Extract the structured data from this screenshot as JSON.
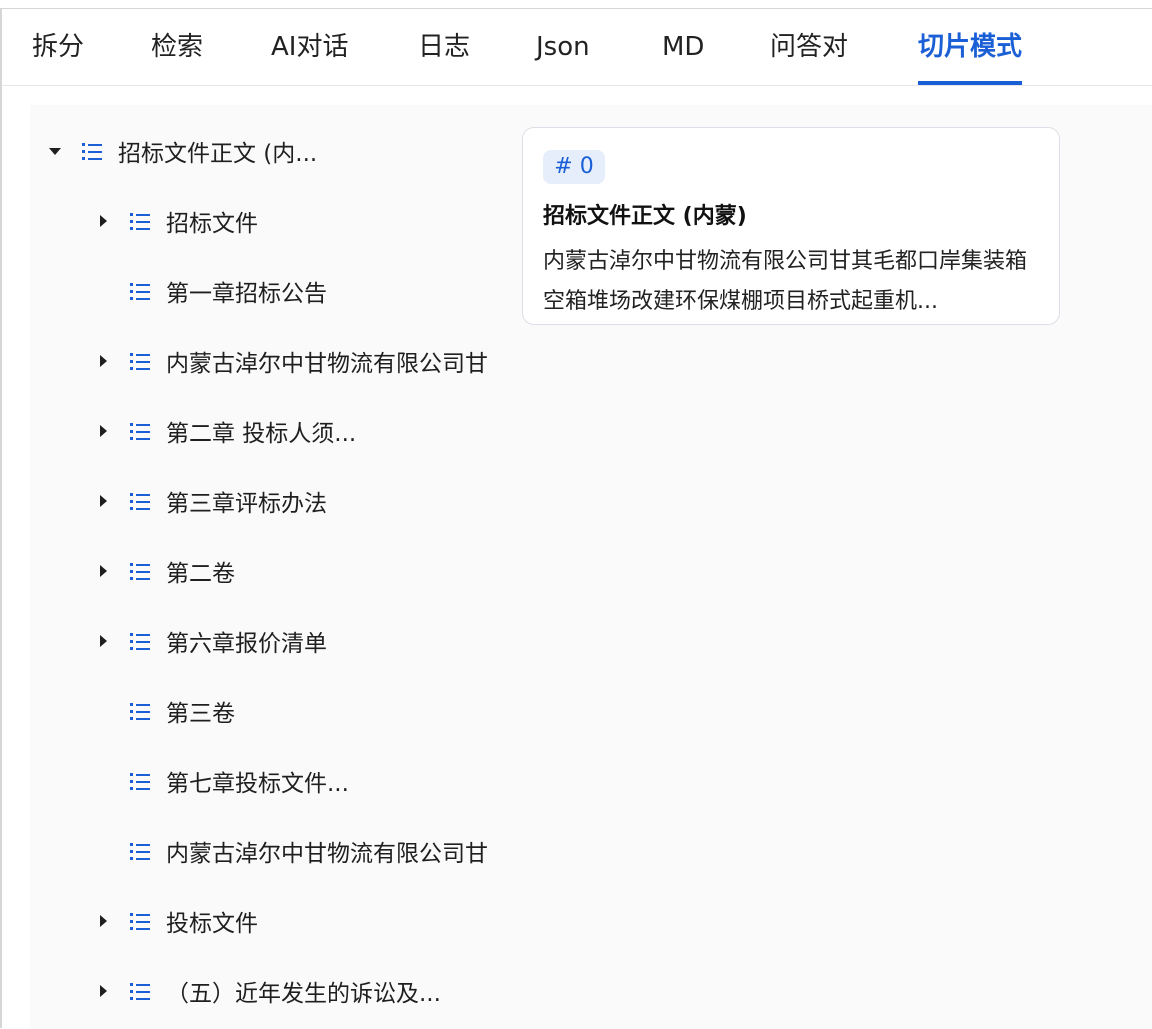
{
  "tabs": [
    {
      "label": "拆分",
      "active": false
    },
    {
      "label": "检索",
      "active": false
    },
    {
      "label": "AI对话",
      "active": false
    },
    {
      "label": "日志",
      "active": false
    },
    {
      "label": "Json",
      "active": false
    },
    {
      "label": "MD",
      "active": false
    },
    {
      "label": "问答对",
      "active": false
    },
    {
      "label": "切片模式",
      "active": true
    }
  ],
  "tree": {
    "root": {
      "label": "招标文件正文 (内...",
      "expanded": true
    },
    "items": [
      {
        "label": "招标文件",
        "has_children": true
      },
      {
        "label": "第一章招标公告",
        "has_children": false
      },
      {
        "label": "内蒙古淖尔中甘物流有限公司甘",
        "has_children": true
      },
      {
        "label": "第二章 投标人须...",
        "has_children": true
      },
      {
        "label": "第三章评标办法",
        "has_children": true
      },
      {
        "label": "第二卷",
        "has_children": true
      },
      {
        "label": "第六章报价清单",
        "has_children": true
      },
      {
        "label": "第三卷",
        "has_children": false
      },
      {
        "label": "第七章投标文件...",
        "has_children": false
      },
      {
        "label": "内蒙古淖尔中甘物流有限公司甘",
        "has_children": false
      },
      {
        "label": "投标文件",
        "has_children": true
      },
      {
        "label": "（五）近年发生的诉讼及...",
        "has_children": true
      }
    ]
  },
  "card": {
    "badge": "# 0",
    "title": "招标文件正文 (内蒙)",
    "body": "内蒙古淖尔中甘物流有限公司甘其毛都口岸集装箱空箱堆场改建环保煤棚项目桥式起重机..."
  },
  "colors": {
    "accent": "#1a5fd6",
    "badge_bg": "#e6eefc",
    "content_bg": "#fafafa"
  }
}
